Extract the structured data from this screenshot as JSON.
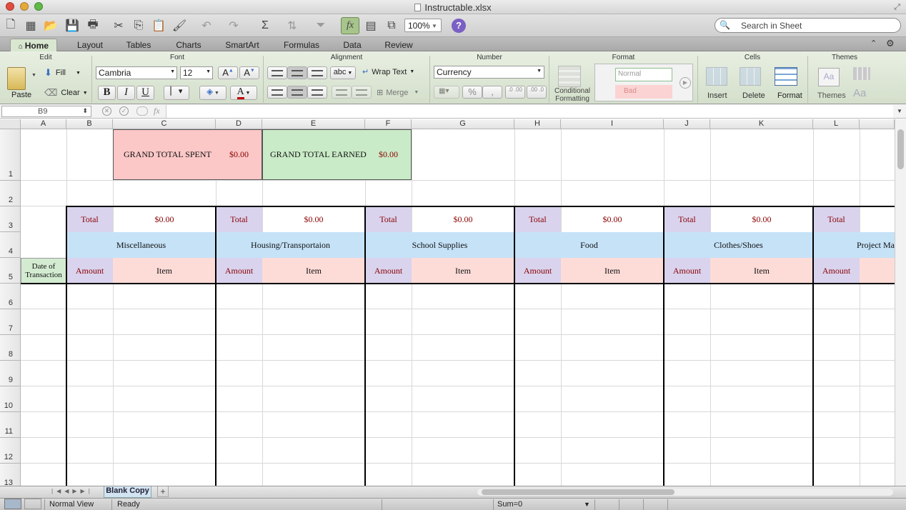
{
  "window": {
    "title": "Instructable.xlsx"
  },
  "toolbar": {
    "zoom": "100%",
    "search_placeholder": "Search in Sheet",
    "fx_label": "fx",
    "help": "?"
  },
  "ribbon_tabs": [
    "Home",
    "Layout",
    "Tables",
    "Charts",
    "SmartArt",
    "Formulas",
    "Data",
    "Review"
  ],
  "ribbon": {
    "groups": {
      "edit": "Edit",
      "font": "Font",
      "alignment": "Alignment",
      "number": "Number",
      "format": "Format",
      "cells": "Cells",
      "themes": "Themes"
    },
    "paste": "Paste",
    "fill": "Fill",
    "clear": "Clear",
    "font_name": "Cambria",
    "font_size": "12",
    "bold": "B",
    "italic": "I",
    "underline": "U",
    "abc": "abc",
    "wrap_text": "Wrap Text",
    "merge": "Merge",
    "number_format": "Currency",
    "percent": "%",
    "comma": ",",
    "dec_inc": ".0 .00",
    "dec_dec": ".00 .0",
    "conditional_formatting": "Conditional Formatting",
    "style_normal": "Normal",
    "style_bad": "Bad",
    "insert": "Insert",
    "delete": "Delete",
    "format_cells": "Format",
    "themes": "Themes",
    "aa": "Aa",
    "font_grow": "A",
    "font_shrink": "A",
    "font_color": "A"
  },
  "formula_bar": {
    "name_box": "B9",
    "fx": "fx",
    "content": ""
  },
  "columns": [
    "A",
    "B",
    "C",
    "D",
    "E",
    "F",
    "G",
    "H",
    "I",
    "J",
    "K",
    "L"
  ],
  "rows": [
    "1",
    "2",
    "3",
    "4",
    "5",
    "6",
    "7",
    "8",
    "9",
    "10",
    "11",
    "12",
    "13"
  ],
  "sheet": {
    "grand_total_spent_label": "GRAND TOTAL SPENT",
    "grand_total_spent_value": "$0.00",
    "grand_total_earned_label": "GRAND TOTAL EARNED",
    "grand_total_earned_value": "$0.00",
    "date_header": "Date of Transaction",
    "categories": [
      {
        "name": "Miscellaneous",
        "total_label": "Total",
        "total": "$0.00",
        "amount": "Amount",
        "item": "Item"
      },
      {
        "name": "Housing/Transportaion",
        "total_label": "Total",
        "total": "$0.00",
        "amount": "Amount",
        "item": "Item"
      },
      {
        "name": "School Supplies",
        "total_label": "Total",
        "total": "$0.00",
        "amount": "Amount",
        "item": "Item"
      },
      {
        "name": "Food",
        "total_label": "Total",
        "total": "$0.00",
        "amount": "Amount",
        "item": "Item"
      },
      {
        "name": "Clothes/Shoes",
        "total_label": "Total",
        "total": "$0.00",
        "amount": "Amount",
        "item": "Item"
      },
      {
        "name": "Project Ma",
        "total_label": "Total",
        "total": "",
        "amount": "Amount",
        "item": ""
      }
    ]
  },
  "sheet_tabs": {
    "active": "Blank Copy",
    "add": "+"
  },
  "status": {
    "view": "Normal View",
    "state": "Ready",
    "sum": "Sum=0"
  },
  "colors": {
    "spent_bg": "#fbc7c7",
    "earned_bg": "#c9ebc7",
    "total_bg": "#d9d3ee",
    "category_bg": "#c5e2f7",
    "amount_bg": "#d9d3ee",
    "item_bg": "#fddcd8",
    "date_bg": "#d3ecd1",
    "money_text": "#8b0000",
    "active_tab": "#d9e7d0"
  }
}
